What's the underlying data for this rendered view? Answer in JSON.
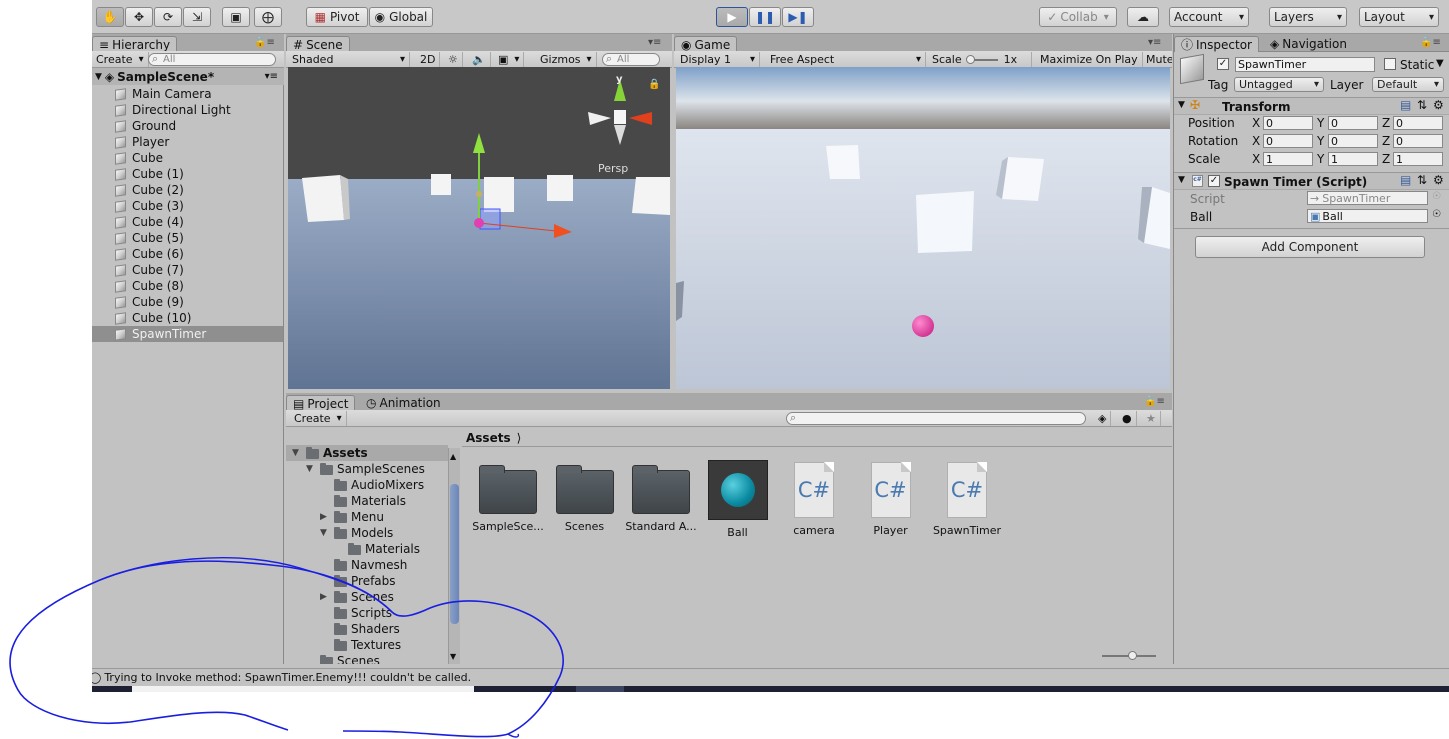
{
  "toolbar": {
    "pivot": "Pivot",
    "global": "Global",
    "collab": "Collab",
    "account": "Account",
    "layers": "Layers",
    "layout": "Layout"
  },
  "hierarchy": {
    "tab": "Hierarchy",
    "create": "Create",
    "search_placeholder": "All",
    "scene": "SampleScene*",
    "items": [
      "Main Camera",
      "Directional Light",
      "Ground",
      "Player",
      "Cube",
      "Cube (1)",
      "Cube (2)",
      "Cube (3)",
      "Cube (4)",
      "Cube (5)",
      "Cube (6)",
      "Cube (7)",
      "Cube (8)",
      "Cube (9)",
      "Cube (10)",
      "SpawnTimer"
    ],
    "selected": "SpawnTimer"
  },
  "scene": {
    "tab": "Scene",
    "shading": "Shaded",
    "mode2d": "2D",
    "gizmos": "Gizmos",
    "search_placeholder": "All",
    "persp": "Persp",
    "axis_y": "y"
  },
  "game": {
    "tab": "Game",
    "display": "Display 1",
    "aspect": "Free Aspect",
    "scale_label": "Scale",
    "scale_value": "1x",
    "maximize": "Maximize On Play",
    "mute": "Mute A"
  },
  "inspector": {
    "tab": "Inspector",
    "nav_tab": "Navigation",
    "object_name": "SpawnTimer",
    "static_label": "Static",
    "tag_label": "Tag",
    "tag_value": "Untagged",
    "layer_label": "Layer",
    "layer_value": "Default",
    "transform": {
      "title": "Transform",
      "position_label": "Position",
      "rotation_label": "Rotation",
      "scale_label": "Scale",
      "position": [
        "0",
        "0",
        "0"
      ],
      "rotation": [
        "0",
        "0",
        "0"
      ],
      "scale": [
        "1",
        "1",
        "1"
      ]
    },
    "script_comp": {
      "title": "Spawn Timer (Script)",
      "script_label": "Script",
      "script_value": "SpawnTimer",
      "ball_label": "Ball",
      "ball_value": "Ball"
    },
    "add_component": "Add Component",
    "axis": [
      "X",
      "Y",
      "Z"
    ]
  },
  "project": {
    "tab": "Project",
    "anim_tab": "Animation",
    "create": "Create",
    "breadcrumb": "Assets",
    "tree": [
      {
        "label": "Assets",
        "depth": 0,
        "arrow": "open",
        "bold": true
      },
      {
        "label": "SampleScenes",
        "depth": 1,
        "arrow": "open"
      },
      {
        "label": "AudioMixers",
        "depth": 2,
        "arrow": ""
      },
      {
        "label": "Materials",
        "depth": 2,
        "arrow": ""
      },
      {
        "label": "Menu",
        "depth": 2,
        "arrow": "closed"
      },
      {
        "label": "Models",
        "depth": 2,
        "arrow": "open"
      },
      {
        "label": "Materials",
        "depth": 3,
        "arrow": ""
      },
      {
        "label": "Navmesh",
        "depth": 2,
        "arrow": ""
      },
      {
        "label": "Prefabs",
        "depth": 2,
        "arrow": ""
      },
      {
        "label": "Scenes",
        "depth": 2,
        "arrow": "closed"
      },
      {
        "label": "Scripts",
        "depth": 2,
        "arrow": ""
      },
      {
        "label": "Shaders",
        "depth": 2,
        "arrow": ""
      },
      {
        "label": "Textures",
        "depth": 2,
        "arrow": ""
      },
      {
        "label": "Scenes",
        "depth": 1,
        "arrow": ""
      }
    ],
    "assets": [
      {
        "label": "SampleSce...",
        "kind": "folder"
      },
      {
        "label": "Scenes",
        "kind": "folder"
      },
      {
        "label": "Standard A...",
        "kind": "folder"
      },
      {
        "label": "Ball",
        "kind": "material"
      },
      {
        "label": "camera",
        "kind": "script",
        "glyph": "C#"
      },
      {
        "label": "Player",
        "kind": "script",
        "glyph": "C#"
      },
      {
        "label": "SpawnTimer",
        "kind": "script",
        "glyph": "C#"
      }
    ]
  },
  "status": {
    "message": "Trying to Invoke method: SpawnTimer.Enemy!!! couldn't be called."
  }
}
